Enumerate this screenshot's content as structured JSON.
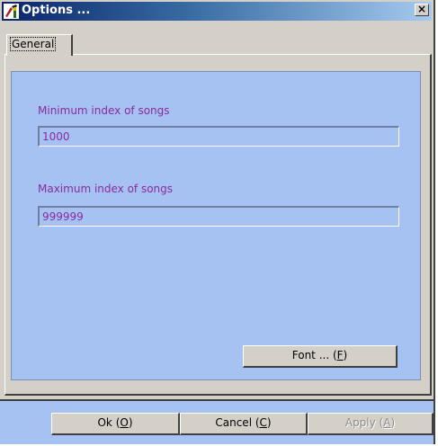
{
  "window": {
    "title": "Options ...",
    "close_glyph": "×",
    "icon": "app-tool-icon"
  },
  "tabs": [
    {
      "label": "General",
      "selected": true
    }
  ],
  "general": {
    "min_label": "Minimum index of songs",
    "min_value": "1000",
    "max_label": "Maximum index of songs",
    "max_value": "999999",
    "font_button": {
      "text": "Font ... (",
      "key": "F",
      "suffix": ")"
    }
  },
  "buttons": {
    "ok": {
      "text": "Ok (",
      "key": "O",
      "suffix": ")"
    },
    "cancel": {
      "text": "Cancel (",
      "key": "C",
      "suffix": ")"
    },
    "apply": {
      "text": "Apply (",
      "key": "A",
      "suffix": ")",
      "enabled": false
    }
  },
  "colors": {
    "panel_bg": "#a6c2f2",
    "label_text": "#8a2ba0",
    "title_gradient_start": "#0a246a",
    "title_gradient_end": "#a6caf0"
  }
}
